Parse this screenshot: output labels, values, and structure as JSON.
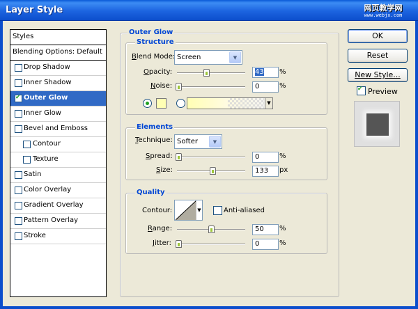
{
  "window": {
    "title": "Layer Style",
    "watermark_text": "网页教学网",
    "watermark_url": "www.webjx.com"
  },
  "sidebar": {
    "styles_label": "Styles",
    "blending_label": "Blending Options: Default",
    "items": [
      {
        "label": "Drop Shadow",
        "checked": false
      },
      {
        "label": "Inner Shadow",
        "checked": false
      },
      {
        "label": "Outer Glow",
        "checked": true
      },
      {
        "label": "Inner Glow",
        "checked": false
      },
      {
        "label": "Bevel and Emboss",
        "checked": false
      },
      {
        "label": "Contour",
        "checked": false
      },
      {
        "label": "Texture",
        "checked": false
      },
      {
        "label": "Satin",
        "checked": false
      },
      {
        "label": "Color Overlay",
        "checked": false
      },
      {
        "label": "Gradient Overlay",
        "checked": false
      },
      {
        "label": "Pattern Overlay",
        "checked": false
      },
      {
        "label": "Stroke",
        "checked": false
      }
    ],
    "selected": "Outer Glow"
  },
  "panel": {
    "title": "Outer Glow",
    "structure": {
      "legend": "Structure",
      "blend_mode_label": "Blend Mode:",
      "blend_mode_value": "Screen",
      "opacity_label": "Opacity:",
      "opacity_value": "43",
      "opacity_level": 43,
      "noise_label": "Noise:",
      "noise_value": "0",
      "noise_level": 0,
      "percent": "%",
      "glow_color": "#ffffb4"
    },
    "elements": {
      "legend": "Elements",
      "technique_label": "Technique:",
      "technique_value": "Softer",
      "spread_label": "Spread:",
      "spread_value": "0",
      "spread_level": 0,
      "size_label": "Size:",
      "size_value": "133",
      "size_level": 53,
      "percent": "%",
      "px": "px"
    },
    "quality": {
      "legend": "Quality",
      "contour_label": "Contour:",
      "anti_aliased_label": "Anti-aliased",
      "anti_aliased": false,
      "range_label": "Range:",
      "range_value": "50",
      "range_level": 50,
      "jitter_label": "Jitter:",
      "jitter_value": "0",
      "jitter_level": 0,
      "percent": "%"
    }
  },
  "buttons": {
    "ok": "OK",
    "reset": "Reset",
    "new_style": "New Style...",
    "preview_label": "Preview",
    "preview_checked": true
  },
  "colors": {
    "accent": "#316ac5",
    "legend": "#0046d5",
    "titlebar": "#0c4ecc"
  }
}
